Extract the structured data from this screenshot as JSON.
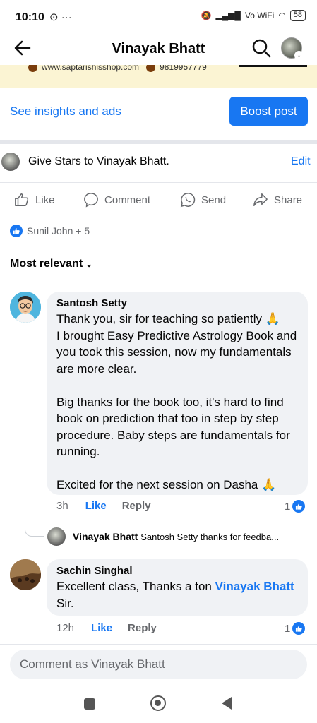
{
  "status": {
    "time": "10:10",
    "battery": "58",
    "network": "Vo WiFi"
  },
  "header": {
    "title": "Vinayak Bhatt"
  },
  "banner": {
    "website": "www.saptarishisshop.com",
    "phone": "9819957779"
  },
  "insights": {
    "link": "See insights and ads",
    "boost": "Boost post"
  },
  "stars": {
    "text": "Give Stars to Vinayak Bhatt.",
    "edit": "Edit"
  },
  "actions": {
    "like": "Like",
    "comment": "Comment",
    "send": "Send",
    "share": "Share"
  },
  "reactions": {
    "summary": "Sunil John + 5"
  },
  "sort": {
    "label": "Most relevant"
  },
  "comments": [
    {
      "author": "Santosh Setty",
      "text": "Thank you, sir for teaching so patiently 🙏\nI brought Easy Predictive Astrology Book and you took this session, now my fundamentals are more clear.\n\nBig thanks for the book too, it's hard to find book on prediction that too in step by step procedure.  Baby steps are fundamentals for running.\n\nExcited for the next session on Dasha 🙏",
      "time": "3h",
      "like": "Like",
      "reply": "Reply",
      "count": "1"
    },
    {
      "author": "Sachin Singhal",
      "text_before": "Excellent class, Thanks a ton ",
      "mention": "Vinayak Bhatt",
      "text_after": " Sir.",
      "time": "12h",
      "like": "Like",
      "reply": "Reply",
      "count": "1"
    }
  ],
  "reply": {
    "author": "Vinayak Bhatt",
    "text": "Santosh Setty thanks for feedba..."
  },
  "composer": {
    "placeholder": "Comment as Vinayak Bhatt"
  },
  "colors": {
    "accent": "#1877f2",
    "banner": "#fbf4d3",
    "bubble": "#f0f2f5"
  }
}
